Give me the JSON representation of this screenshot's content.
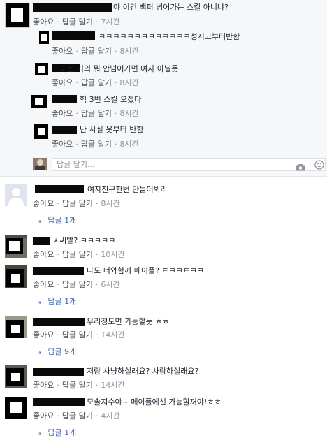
{
  "comments": [
    {
      "text": "야 이건 백퍼 넘어가는 스킬 아니냐?",
      "like": "좋아요",
      "reply": "답글 달기",
      "time": "7시간"
    },
    {
      "text": "ㅋㅋㅋㅋㅋㅋㅋㅋㅋㅋㅋㅋㅋ성지고부터반함",
      "like": "좋아요",
      "reply": "답글 달기",
      "time": "8시간"
    },
    {
      "text": "이건 거의 뭐 안넘어가면 여자 아닐듯",
      "like": "좋아요",
      "reply": "답글 달기",
      "time": "8시간"
    },
    {
      "text": "헉 3번 스킬 오졌다",
      "like": "좋아요",
      "reply": "답글 달기",
      "time": "8시간"
    },
    {
      "text": "난 사실 옷부터 반함",
      "like": "좋아요",
      "reply": "답글 달기",
      "time": "8시간"
    },
    {
      "text": "여자친구한번 만들어봐라",
      "like": "좋아요",
      "reply": "답글 달기",
      "time": "8시간",
      "replies": "답글 1개"
    },
    {
      "text": "ㅅ씨발? ㅋㅋㅋㅋㅋ",
      "like": "좋아요",
      "reply": "답글 달기",
      "time": "10시간"
    },
    {
      "text": "나도 너와함께 메이플? ㅌㅋㅋㅌㅋㅋ",
      "like": "좋아요",
      "reply": "답글 달기",
      "time": "6시간",
      "replies": "답글 1개"
    },
    {
      "text": "우리정도면 가능할듯 ㅎㅎ",
      "like": "좋아요",
      "reply": "답글 달기",
      "time": "14시간",
      "replies": "답글 9개"
    },
    {
      "text": "저랑 사냥하실래요? 사랑하실래요?",
      "like": "좋아요",
      "reply": "답글 달기",
      "time": "14시간"
    },
    {
      "text": "모솔지수야~ 메이플에선 가능할꺼야!ㅎㅎ",
      "like": "좋아요",
      "reply": "답글 달기",
      "time": "4시간",
      "replies": "답글 1개"
    }
  ],
  "composer": {
    "placeholder": "답글 달기..."
  },
  "icons": {
    "camera": "camera-icon",
    "emoji": "emoji-icon",
    "reply_arrow": "reply-arrow-icon"
  },
  "colors": {
    "link": "#4267b2",
    "meta": "#90949c",
    "panel": "#f6f7f9"
  }
}
